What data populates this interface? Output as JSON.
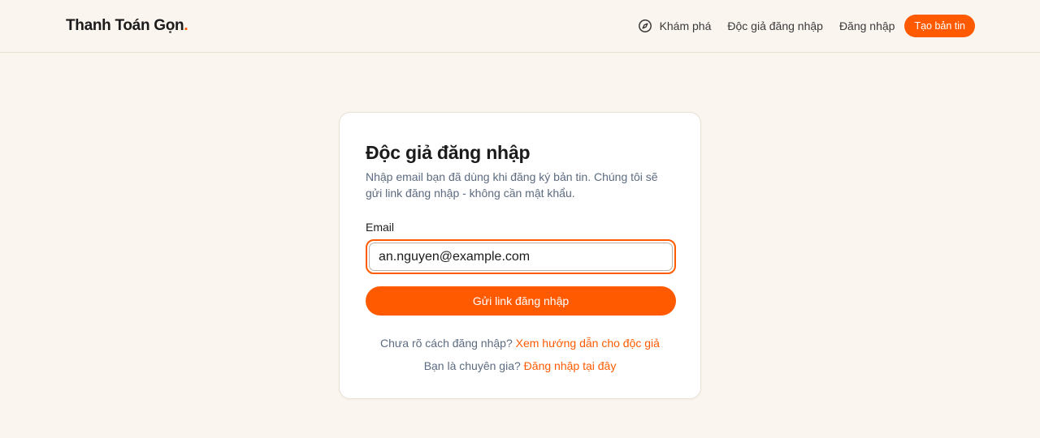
{
  "header": {
    "brand": "Thanh Toán Gọn",
    "brand_dot": ".",
    "nav": {
      "explore_label": "Khám phá",
      "reader_login_label": "Độc giả đăng nhập",
      "login_label": "Đăng nhập",
      "create_label": "Tạo bản tin"
    }
  },
  "card": {
    "title": "Độc giả đăng nhập",
    "description": "Nhập email bạn đã dùng khi đăng ký bản tin. Chúng tôi sẽ gửi link đăng nhập - không cần mật khẩu.",
    "email_label": "Email",
    "email_value": "an.nguyen@example.com",
    "submit_label": "Gửi link đăng nhập",
    "help_prompt": "Chưa rõ cách đăng nhập?",
    "help_link": "Xem hướng dẫn cho độc giả",
    "expert_prompt": "Bạn là chuyên gia?",
    "expert_link": "Đăng nhập tại đây"
  },
  "icons": {
    "explore": "compass-icon"
  },
  "colors": {
    "accent": "#ff5a00",
    "background": "#faf5ef",
    "muted_text": "#5c6b80"
  }
}
